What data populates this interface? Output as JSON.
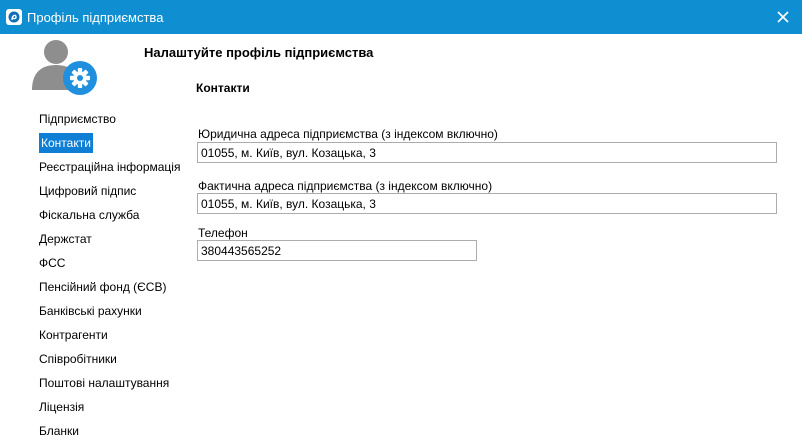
{
  "window": {
    "title": "Профіль підприємства"
  },
  "icons": {
    "app": "app-logo-icon",
    "close": "close-icon",
    "avatar": "user-settings-icon"
  },
  "colors": {
    "titlebar": "#0f8fd1",
    "selected": "#0f7fd6"
  },
  "header": {
    "heading": "Налаштуйте профіль підприємства",
    "section_title": "Контакти"
  },
  "sidebar": {
    "items": [
      {
        "label": "Підприємство"
      },
      {
        "label": "Контакти"
      },
      {
        "label": "Реєстраційна інформація"
      },
      {
        "label": "Цифровий підпис"
      },
      {
        "label": "Фіскальна служба"
      },
      {
        "label": "Держстат"
      },
      {
        "label": "ФСС"
      },
      {
        "label": "Пенсійний фонд (ЄСВ)"
      },
      {
        "label": "Банківські рахунки"
      },
      {
        "label": "Контрагенти"
      },
      {
        "label": "Співробітники"
      },
      {
        "label": "Поштові налаштування"
      },
      {
        "label": "Ліцензія"
      },
      {
        "label": "Бланки"
      }
    ],
    "selected": "Контакти"
  },
  "form": {
    "legal_address": {
      "label": "Юридична адреса підприємства (з індексом включно)",
      "value": "01055, м. Київ, вул. Козацька, 3"
    },
    "actual_address": {
      "label": "Фактична адреса підприємства (з індексом включно)",
      "value": "01055, м. Київ, вул. Козацька, 3"
    },
    "phone": {
      "label": "Телефон",
      "value": "380443565252"
    }
  }
}
